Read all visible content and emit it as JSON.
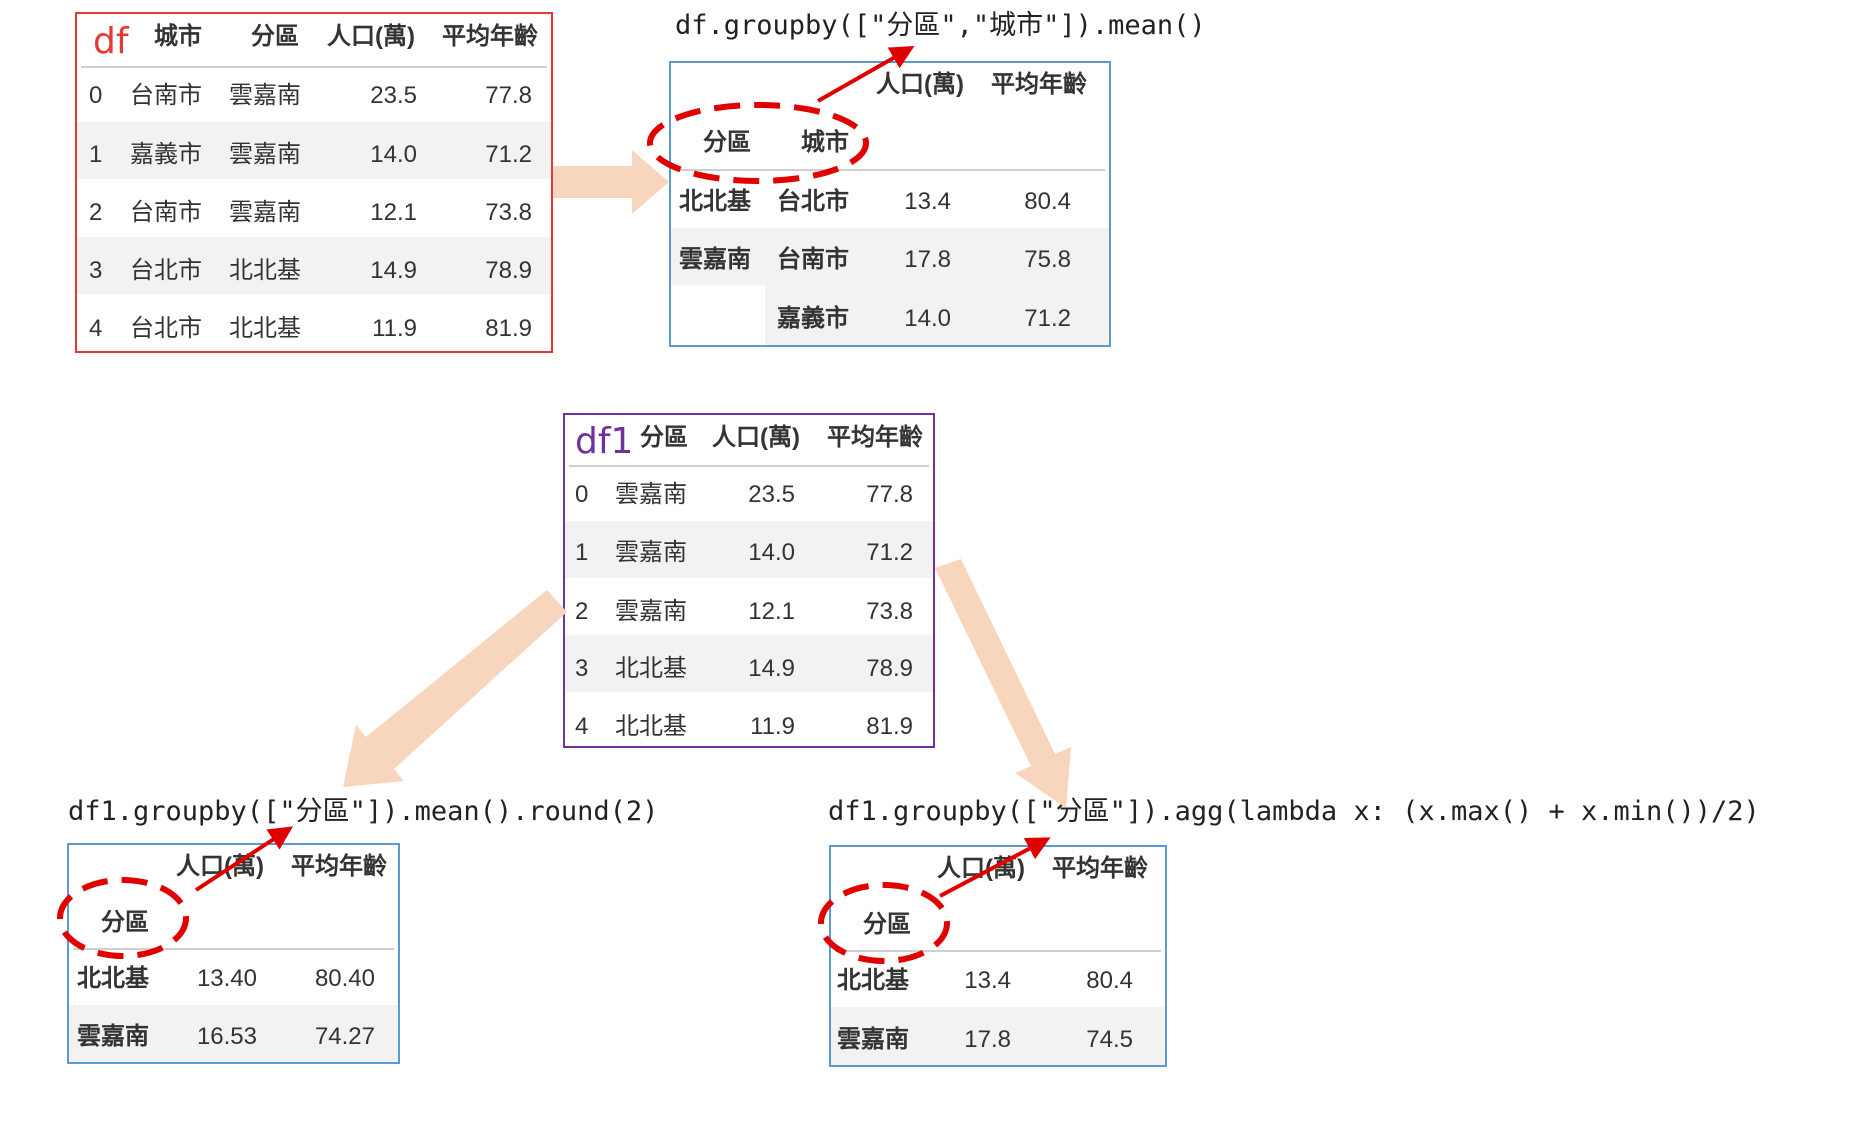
{
  "df_panel": {
    "label": "df",
    "headers": [
      "城市",
      "分區",
      "人口(萬)",
      "平均年齡"
    ],
    "rows": [
      [
        "0",
        "台南市",
        "雲嘉南",
        "23.5",
        "77.8"
      ],
      [
        "1",
        "嘉義市",
        "雲嘉南",
        "14.0",
        "71.2"
      ],
      [
        "2",
        "台南市",
        "雲嘉南",
        "12.1",
        "73.8"
      ],
      [
        "3",
        "台北市",
        "北北基",
        "14.9",
        "78.9"
      ],
      [
        "4",
        "台北市",
        "北北基",
        "11.9",
        "81.9"
      ]
    ]
  },
  "group_city": {
    "code": "df.groupby([\"分區\",\"城市\"]).mean()",
    "col_headers": [
      "人口(萬)",
      "平均年齡"
    ],
    "index_headers": [
      "分區",
      "城市"
    ],
    "rows": [
      [
        "北北基",
        "台北市",
        "13.4",
        "80.4"
      ],
      [
        "雲嘉南",
        "台南市",
        "17.8",
        "75.8"
      ],
      [
        "",
        "嘉義市",
        "14.0",
        "71.2"
      ]
    ]
  },
  "df1_panel": {
    "label": "df1",
    "headers": [
      "分區",
      "人口(萬)",
      "平均年齡"
    ],
    "rows": [
      [
        "0",
        "雲嘉南",
        "23.5",
        "77.8"
      ],
      [
        "1",
        "雲嘉南",
        "14.0",
        "71.2"
      ],
      [
        "2",
        "雲嘉南",
        "12.1",
        "73.8"
      ],
      [
        "3",
        "北北基",
        "14.9",
        "78.9"
      ],
      [
        "4",
        "北北基",
        "11.9",
        "81.9"
      ]
    ]
  },
  "group_mean": {
    "code": "df1.groupby([\"分區\"]).mean().round(2)",
    "col_headers": [
      "人口(萬)",
      "平均年齡"
    ],
    "index_header": "分區",
    "rows": [
      [
        "北北基",
        "13.40",
        "80.40"
      ],
      [
        "雲嘉南",
        "16.53",
        "74.27"
      ]
    ]
  },
  "group_agg": {
    "code": "df1.groupby([\"分區\"]).agg(lambda x: (x.max() + x.min())/2)",
    "col_headers": [
      "人口(萬)",
      "平均年齡"
    ],
    "index_header": "分區",
    "rows": [
      [
        "北北基",
        "13.4",
        "80.4"
      ],
      [
        "雲嘉南",
        "17.8",
        "74.5"
      ]
    ]
  },
  "colors": {
    "df_border": "#e53935",
    "df1_border": "#7030a0",
    "result_border": "#5b9bd5",
    "flow_arrow": "#f8d5bd",
    "highlight": "#e00000"
  }
}
